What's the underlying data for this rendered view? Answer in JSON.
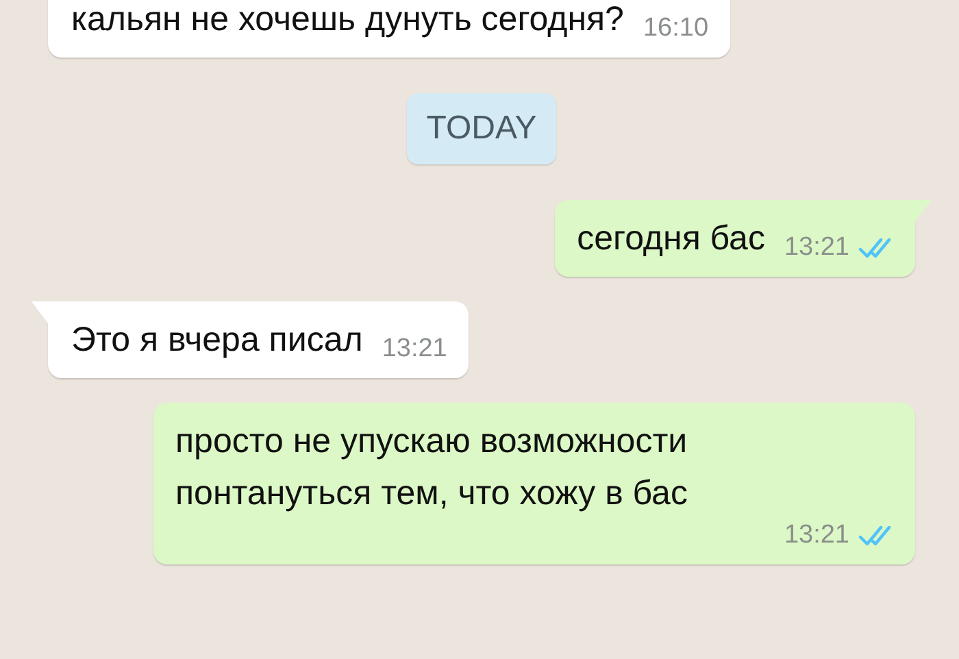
{
  "messages": [
    {
      "kind": "incoming",
      "text": "кальян не хочешь дунуть сегодня?",
      "time": "16:10",
      "tail": false
    },
    {
      "kind": "date",
      "text": "TODAY"
    },
    {
      "kind": "outgoing",
      "text": "сегодня бас",
      "time": "13:21",
      "read": true,
      "tail": true
    },
    {
      "kind": "incoming",
      "text": "Это я вчера писал",
      "time": "13:21",
      "tail": true
    },
    {
      "kind": "outgoing",
      "text": "просто не упускаю возможности понтануться тем, что хожу в бас",
      "time": "13:21",
      "read": true,
      "tail": false
    }
  ]
}
